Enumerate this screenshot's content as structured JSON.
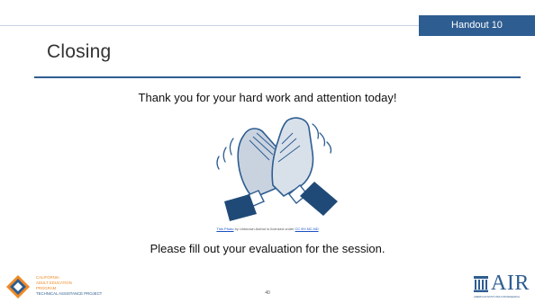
{
  "header": {
    "handout_label": "Handout 10"
  },
  "slide": {
    "title": "Closing",
    "thanks_text": "Thank you for your hard work and attention today!",
    "evaluation_text": "Please fill out your evaluation for the session.",
    "page_number": "40"
  },
  "image_credit": {
    "link_text": "This Photo",
    "middle_text": " by Unknown Author is licensed under ",
    "license_text": "CC BY-NC-ND"
  },
  "logos": {
    "caep_lines": [
      "California",
      "Adult Education",
      "Program",
      "Technical Assistance Project"
    ],
    "air_text": "AIR",
    "air_tagline": "AMERICAN INSTITUTES FOR RESEARCH"
  },
  "colors": {
    "accent_blue": "#2e5d91",
    "caep_orange": "#f08a24"
  }
}
